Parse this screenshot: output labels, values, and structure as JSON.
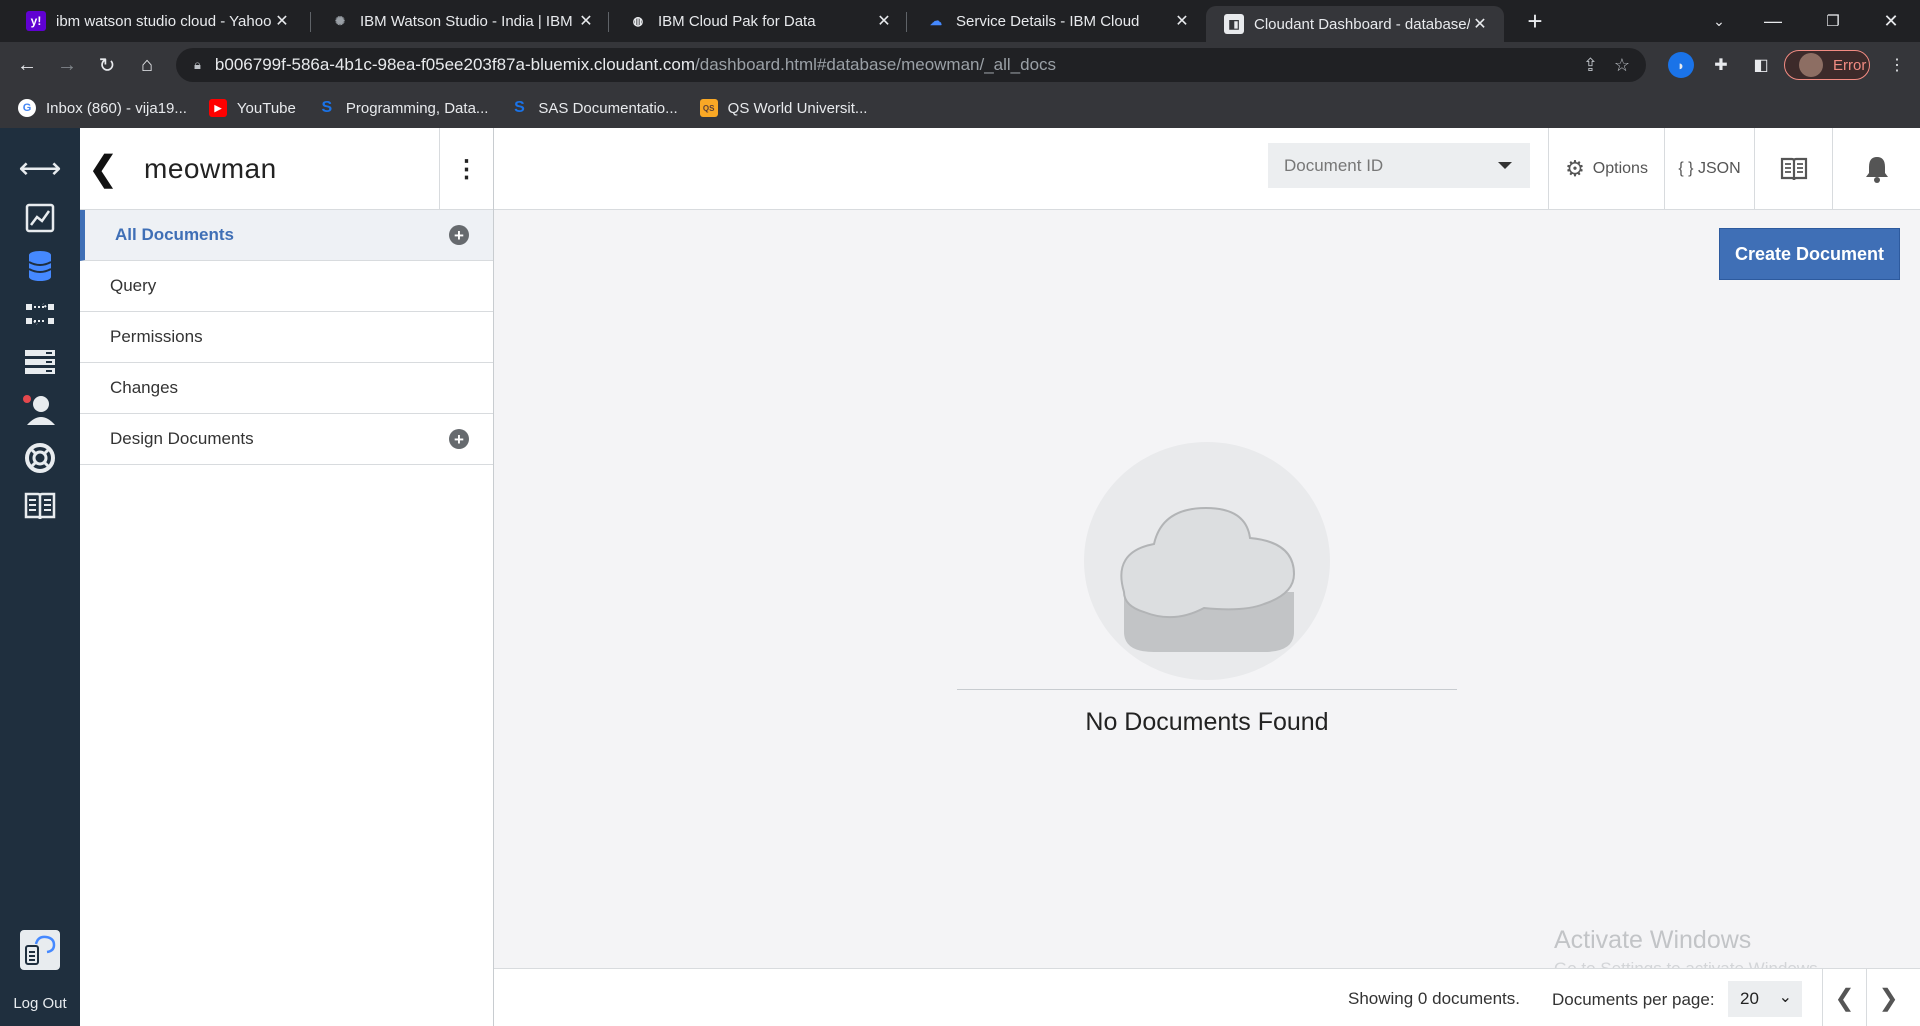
{
  "browser": {
    "tabs": [
      {
        "title": "ibm watson studio cloud - Yahoo",
        "favicon": "yahoo-icon",
        "favicon_text": "y!",
        "favicon_color": "#6001d2"
      },
      {
        "title": "IBM Watson Studio - India | IBM",
        "favicon": "watson-icon",
        "favicon_text": "✺",
        "favicon_color": "#202124"
      },
      {
        "title": "IBM Cloud Pak for Data",
        "favicon": "cloudpak-icon",
        "favicon_text": "◍",
        "favicon_color": "#202124"
      },
      {
        "title": "Service Details - IBM Cloud",
        "favicon": "ibmcloud-icon",
        "favicon_text": "☁",
        "favicon_color": "#202124"
      },
      {
        "title": "Cloudant Dashboard - database/",
        "favicon": "cloudant-icon",
        "favicon_text": "◧",
        "favicon_color": "#e8eaed",
        "active": true
      }
    ],
    "new_tab_label": "+",
    "close_glyph": "✕",
    "url_host": "b006799f-586a-4b1c-98ea-f05ee203f87a-bluemix.cloudant.com",
    "url_path": "/dashboard.html#database/meowman/_all_docs",
    "profile_status": "Error",
    "bookmarks": [
      {
        "label": "Inbox (860) - vija19...",
        "icon": "google-icon",
        "glyph": "G",
        "color": "#ffffff",
        "fg": "#4285f4"
      },
      {
        "label": "YouTube",
        "icon": "youtube-icon",
        "glyph": "▶",
        "color": "#ff0000",
        "fg": "#ffffff"
      },
      {
        "label": "Programming, Data...",
        "icon": "s-logo-icon",
        "glyph": "S",
        "color": "#35363a",
        "fg": "#1a73e8"
      },
      {
        "label": "SAS Documentatio...",
        "icon": "sas-icon",
        "glyph": "S",
        "color": "#35363a",
        "fg": "#1a73e8"
      },
      {
        "label": "QS World Universit...",
        "icon": "qs-icon",
        "glyph": "QS",
        "color": "#f9a825",
        "fg": "#5d4037"
      }
    ]
  },
  "rail": {
    "logout_label": "Log Out"
  },
  "database": {
    "name": "meowman",
    "back_glyph": "❮",
    "menu_glyph": "⋮",
    "nav": [
      {
        "label": "All Documents",
        "active": true,
        "plus": true
      },
      {
        "label": "Query"
      },
      {
        "label": "Permissions"
      },
      {
        "label": "Changes"
      },
      {
        "label": "Design Documents",
        "plus": true
      }
    ],
    "plus_glyph": "+"
  },
  "toolbar": {
    "docid_placeholder": "Document ID",
    "options_label": "Options",
    "json_label": "{ } JSON"
  },
  "main": {
    "create_label": "Create Document",
    "empty_message": "No Documents Found"
  },
  "watermark": {
    "title": "Activate Windows",
    "subtitle": "Go to Settings to activate Windows."
  },
  "footer": {
    "showing": "Showing 0 documents.",
    "per_page_label": "Documents per page:",
    "per_page_value": "20",
    "prev_glyph": "❮",
    "next_glyph": "❯"
  },
  "colors": {
    "accent": "#3f6fb6",
    "rail_bg": "#1f2f3e",
    "error": "#f28b82"
  }
}
